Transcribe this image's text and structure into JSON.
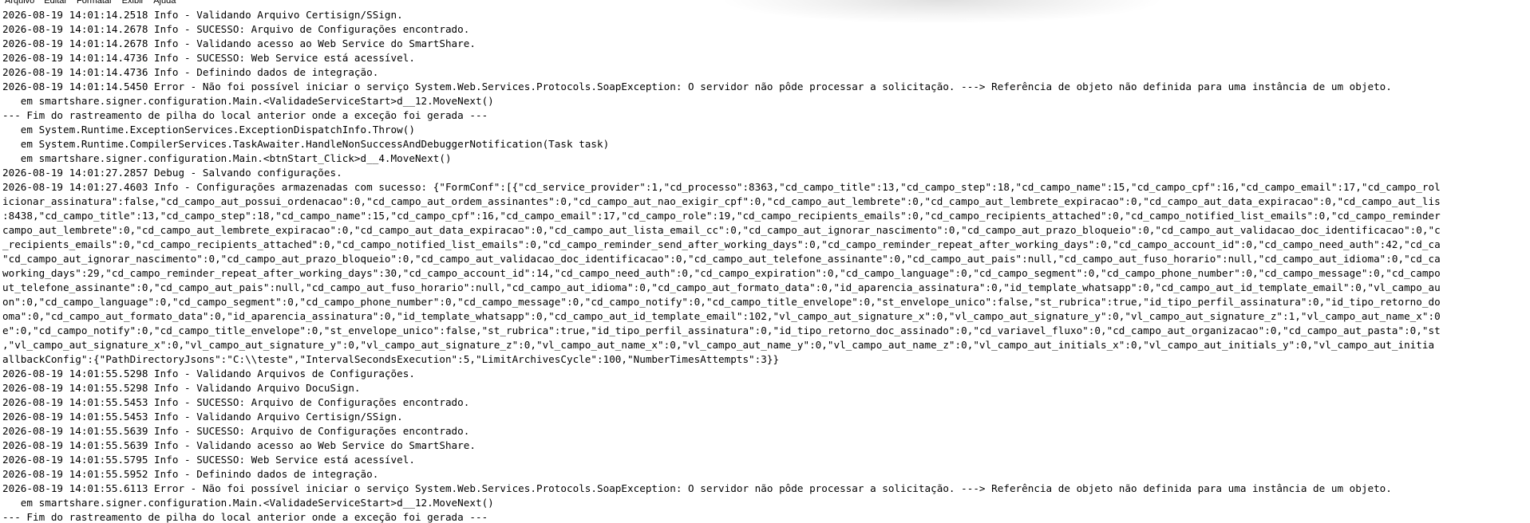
{
  "menu": [
    "Arquivo",
    "Editar",
    "Formatar",
    "Exibir",
    "Ajuda"
  ],
  "log_lines": [
    "2026-08-19 14:01:14.2518 Info - Validando Arquivo Certisign/SSign.",
    "2026-08-19 14:01:14.2678 Info - SUCESSO: Arquivo de Configurações encontrado.",
    "2026-08-19 14:01:14.2678 Info - Validando acesso ao Web Service do SmartShare.",
    "2026-08-19 14:01:14.4736 Info - SUCESSO: Web Service está acessível.",
    "2026-08-19 14:01:14.4736 Info - Definindo dados de integração.",
    "2026-08-19 14:01:14.5450 Error - Não foi possível iniciar o serviço System.Web.Services.Protocols.SoapException: O servidor não pôde processar a solicitação. ---> Referência de objeto não definida para uma instância de um objeto.",
    "   em smartshare.signer.configuration.Main.<ValidadeServiceStart>d__12.MoveNext()",
    "--- Fim do rastreamento de pilha do local anterior onde a exceção foi gerada ---",
    "   em System.Runtime.ExceptionServices.ExceptionDispatchInfo.Throw()",
    "   em System.Runtime.CompilerServices.TaskAwaiter.HandleNonSuccessAndDebuggerNotification(Task task)",
    "   em smartshare.signer.configuration.Main.<btnStart_Click>d__4.MoveNext()",
    "2026-08-19 14:01:27.2857 Debug - Salvando configurações.",
    "2026-08-19 14:01:27.4603 Info - Configurações armazenadas com sucesso: {\"FormConf\":[{\"cd_service_provider\":1,\"cd_processo\":8363,\"cd_campo_title\":13,\"cd_campo_step\":18,\"cd_campo_name\":15,\"cd_campo_cpf\":16,\"cd_campo_email\":17,\"cd_campo_rol",
    "icionar_assinatura\":false,\"cd_campo_aut_possui_ordenacao\":0,\"cd_campo_aut_ordem_assinantes\":0,\"cd_campo_aut_nao_exigir_cpf\":0,\"cd_campo_aut_lembrete\":0,\"cd_campo_aut_lembrete_expiracao\":0,\"cd_campo_aut_data_expiracao\":0,\"cd_campo_aut_lis",
    ":8438,\"cd_campo_title\":13,\"cd_campo_step\":18,\"cd_campo_name\":15,\"cd_campo_cpf\":16,\"cd_campo_email\":17,\"cd_campo_role\":19,\"cd_campo_recipients_emails\":0,\"cd_campo_recipients_attached\":0,\"cd_campo_notified_list_emails\":0,\"cd_campo_reminder",
    "campo_aut_lembrete\":0,\"cd_campo_aut_lembrete_expiracao\":0,\"cd_campo_aut_data_expiracao\":0,\"cd_campo_aut_lista_email_cc\":0,\"cd_campo_aut_ignorar_nascimento\":0,\"cd_campo_aut_prazo_bloqueio\":0,\"cd_campo_aut_validacao_doc_identificacao\":0,\"c",
    "_recipients_emails\":0,\"cd_campo_recipients_attached\":0,\"cd_campo_notified_list_emails\":0,\"cd_campo_reminder_send_after_working_days\":0,\"cd_campo_reminder_repeat_after_working_days\":0,\"cd_campo_account_id\":0,\"cd_campo_need_auth\":42,\"cd_ca",
    "\"cd_campo_aut_ignorar_nascimento\":0,\"cd_campo_aut_prazo_bloqueio\":0,\"cd_campo_aut_validacao_doc_identificacao\":0,\"cd_campo_aut_telefone_assinante\":0,\"cd_campo_aut_pais\":null,\"cd_campo_aut_fuso_horario\":null,\"cd_campo_aut_idioma\":0,\"cd_ca",
    "working_days\":29,\"cd_campo_reminder_repeat_after_working_days\":30,\"cd_campo_account_id\":14,\"cd_campo_need_auth\":0,\"cd_campo_expiration\":0,\"cd_campo_language\":0,\"cd_campo_segment\":0,\"cd_campo_phone_number\":0,\"cd_campo_message\":0,\"cd_campo",
    "ut_telefone_assinante\":0,\"cd_campo_aut_pais\":null,\"cd_campo_aut_fuso_horario\":null,\"cd_campo_aut_idioma\":0,\"cd_campo_aut_formato_data\":0,\"id_aparencia_assinatura\":0,\"id_template_whatsapp\":0,\"cd_campo_aut_id_template_email\":0,\"vl_campo_au",
    "on\":0,\"cd_campo_language\":0,\"cd_campo_segment\":0,\"cd_campo_phone_number\":0,\"cd_campo_message\":0,\"cd_campo_notify\":0,\"cd_campo_title_envelope\":0,\"st_envelope_unico\":false,\"st_rubrica\":true,\"id_tipo_perfil_assinatura\":0,\"id_tipo_retorno_do",
    "oma\":0,\"cd_campo_aut_formato_data\":0,\"id_aparencia_assinatura\":0,\"id_template_whatsapp\":0,\"cd_campo_aut_id_template_email\":102,\"vl_campo_aut_signature_x\":0,\"vl_campo_aut_signature_y\":0,\"vl_campo_aut_signature_z\":1,\"vl_campo_aut_name_x\":0",
    "e\":0,\"cd_campo_notify\":0,\"cd_campo_title_envelope\":0,\"st_envelope_unico\":false,\"st_rubrica\":true,\"id_tipo_perfil_assinatura\":0,\"id_tipo_retorno_doc_assinado\":0,\"cd_variavel_fluxo\":0,\"cd_campo_aut_organizacao\":0,\"cd_campo_aut_pasta\":0,\"st",
    ",\"vl_campo_aut_signature_x\":0,\"vl_campo_aut_signature_y\":0,\"vl_campo_aut_signature_z\":0,\"vl_campo_aut_name_x\":0,\"vl_campo_aut_name_y\":0,\"vl_campo_aut_name_z\":0,\"vl_campo_aut_initials_x\":0,\"vl_campo_aut_initials_y\":0,\"vl_campo_aut_initia",
    "allbackConfig\":{\"PathDirectoryJsons\":\"C:\\\\teste\",\"IntervalSecondsExecution\":5,\"LimitArchivesCycle\":100,\"NumberTimesAttempts\":3}}",
    "2026-08-19 14:01:55.5298 Info - Validando Arquivos de Configurações.",
    "2026-08-19 14:01:55.5298 Info - Validando Arquivo DocuSign.",
    "2026-08-19 14:01:55.5453 Info - SUCESSO: Arquivo de Configurações encontrado.",
    "2026-08-19 14:01:55.5453 Info - Validando Arquivo Certisign/SSign.",
    "2026-08-19 14:01:55.5639 Info - SUCESSO: Arquivo de Configurações encontrado.",
    "2026-08-19 14:01:55.5639 Info - Validando acesso ao Web Service do SmartShare.",
    "2026-08-19 14:01:55.5795 Info - SUCESSO: Web Service está acessível.",
    "2026-08-19 14:01:55.5952 Info - Definindo dados de integração.",
    "2026-08-19 14:01:55.6113 Error - Não foi possível iniciar o serviço System.Web.Services.Protocols.SoapException: O servidor não pôde processar a solicitação. ---> Referência de objeto não definida para uma instância de um objeto.",
    "   em smartshare.signer.configuration.Main.<ValidadeServiceStart>d__12.MoveNext()",
    "--- Fim do rastreamento de pilha do local anterior onde a exceção foi gerada ---"
  ]
}
